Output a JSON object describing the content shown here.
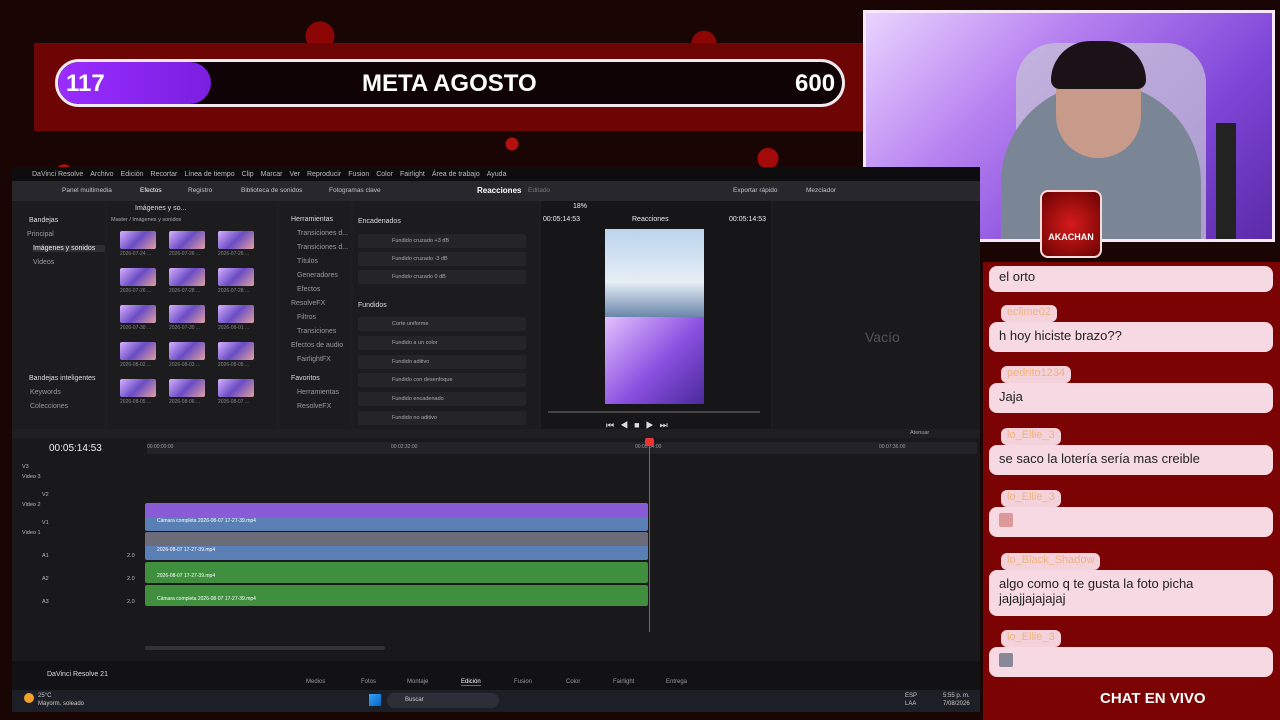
{
  "goal": {
    "current": "117",
    "title": "META AGOSTO",
    "target": "600",
    "progress": 0.195
  },
  "badge": {
    "text": "AKACHAN"
  },
  "chat": {
    "messages": [
      {
        "name": "",
        "text": "el orto"
      },
      {
        "name": "eclime02",
        "text": "h hoy hiciste brazo??"
      },
      {
        "name": "pedrito1234",
        "text": "Jaja"
      },
      {
        "name": "lo_Ellie_3",
        "text": "se saco la lotería sería mas creible"
      },
      {
        "name": "lo_Ellie_3",
        "text": ""
      },
      {
        "name": "lo_Black_Shadow",
        "text": "algo como q te gusta la foto picha jajajjajajajaj"
      },
      {
        "name": "lo_Ellie_3",
        "text": ""
      }
    ],
    "footer": "CHAT EN VIVO"
  },
  "resolve": {
    "menu": [
      "DaVinci Resolve",
      "Archivo",
      "Edición",
      "Recortar",
      "Línea de tiempo",
      "Clip",
      "Marcar",
      "Ver",
      "Reproducir",
      "Fusion",
      "Color",
      "Fairlight",
      "Área de trabajo",
      "Ayuda"
    ],
    "toolbar": {
      "media_pool": "Panel multimedia",
      "effects": "Efectos",
      "edit_index": "Registro",
      "sound_library": "Biblioteca de sonidos",
      "keyframes": "Fotogramas clave",
      "project_title": "Reacciones",
      "project_status": "Editado",
      "quick_export": "Exportar rápido",
      "mixer": "Mezclador"
    },
    "bins": {
      "header": "Bandejas",
      "items": [
        "Principal",
        "Imágenes y sonidos",
        "Videos"
      ],
      "smart_header": "Bandejas inteligentes",
      "smart_items": [
        "Keywords",
        "Colecciones"
      ]
    },
    "media": {
      "path": "Master / Imágenes y sonidos",
      "folder": "Imágenes y so...",
      "thumbs": [
        "2026-07-24 ...",
        "2026-07-26 ...",
        "2026-07-26 ...",
        "2026-07-26 ...",
        "2026-07-28 ...",
        "2026-07-28 ...",
        "2026-07-30 ...",
        "2026-07-30 ...",
        "2026-08-01 ...",
        "2026-08-02 ...",
        "2026-08-03 ...",
        "2026-08-05 ...",
        "2026-08-05 ...",
        "2026-08-06 ...",
        "2026-08-07 ..."
      ]
    },
    "tools": {
      "header": "Herramientas",
      "items": [
        "Transiciones d...",
        "Transiciones d...",
        "Títulos",
        "Generadores",
        "Efectos",
        "ResolveFX",
        "Filtros",
        "Transiciones",
        "Efectos de audio",
        "FairlightFX"
      ],
      "favorites_header": "Favoritos",
      "favorites": [
        "Herramientas",
        "ResolveFX"
      ]
    },
    "effects": {
      "section1": "Encadenados",
      "items1": [
        "Fundido cruzado +3 dB",
        "Fundido cruzado -3 dB",
        "Fundido cruzado 0 dB"
      ],
      "section2": "Fundidos",
      "items2": [
        "Corte uniforme",
        "Fundido a un color",
        "Fundido aditivo",
        "Fundido con desenfoque",
        "Fundido encadenado",
        "Fundido no aditivo"
      ]
    },
    "viewer": {
      "timecode_left": "00:05:14:53",
      "zoom": "18%",
      "clip_name": "Reacciones",
      "timecode_right": "00:05:14:53",
      "empty": "Vacío"
    },
    "timeline": {
      "timecode": "00:05:14:53",
      "ruler": [
        "00:00:00:00",
        "00:02:32:00",
        "00:05:04:00",
        "00:07:36:00"
      ],
      "tracks": [
        {
          "id": "V3",
          "name": "Video 3"
        },
        {
          "id": "V2",
          "name": "Video 2"
        },
        {
          "id": "V1",
          "name": "Video 1"
        },
        {
          "id": "A1",
          "level": "2.0"
        },
        {
          "id": "A2",
          "level": "2.0"
        },
        {
          "id": "A3",
          "level": "2.0"
        }
      ],
      "clips": [
        "Cámara completa 2026-08-07 17-27-39.mp4",
        "2026-08-07 17-27-39.mp4",
        "2026-08-07 17-27-39.mp4",
        "Cámara completa 2026-08-07 17-27-39.mp4"
      ],
      "attenuate": "Atenuar"
    },
    "pages": [
      "Medios",
      "Fotos",
      "Montaje",
      "Edición",
      "Fusion",
      "Color",
      "Fairlight",
      "Entrega"
    ],
    "active_page": "Edición",
    "app_name": "DaVinci Resolve 21"
  },
  "taskbar": {
    "weather_temp": "25°C",
    "weather_desc": "Mayorm. soleado",
    "search": "Buscar",
    "lang": "ESP",
    "lang2": "LAA",
    "time": "5:55 p. m.",
    "date": "7/08/2026"
  },
  "colors": {
    "accent": "#8a2be2",
    "brand_red": "#7b0303",
    "clip_video": "#5a7fb5",
    "clip_audio": "#3f8f3f",
    "playhead": "#e33"
  }
}
